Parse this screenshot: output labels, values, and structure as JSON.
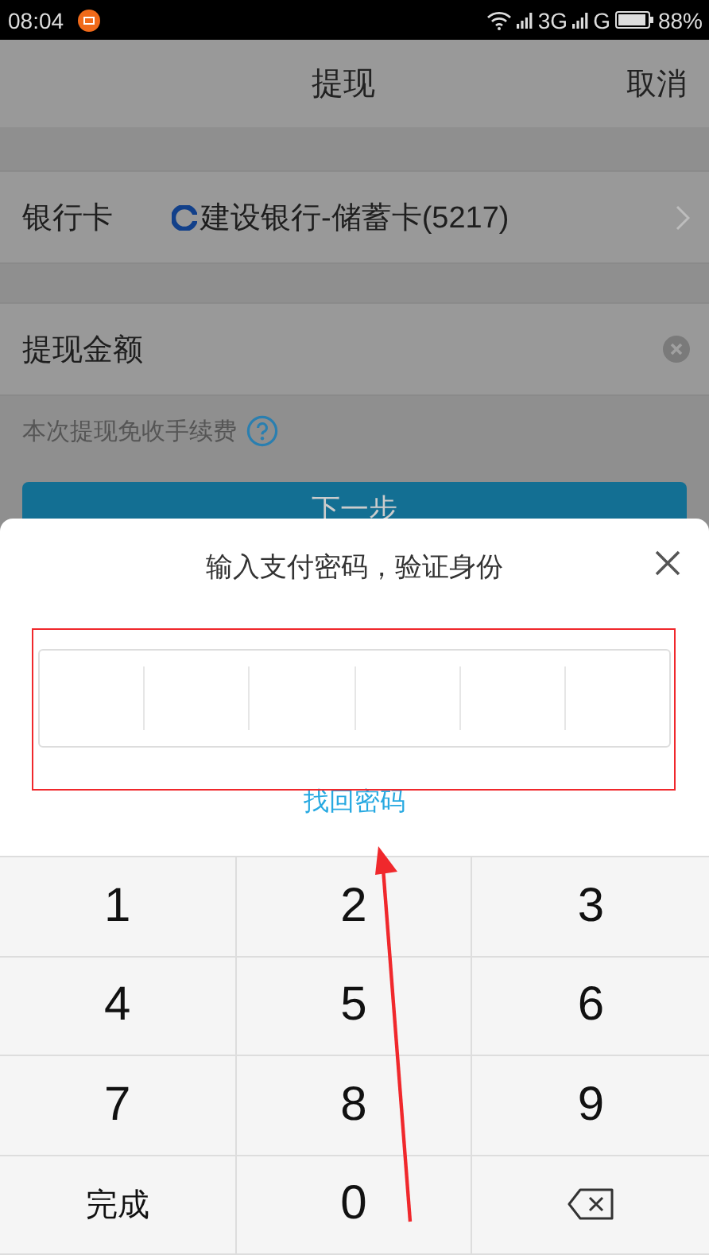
{
  "status_bar": {
    "time": "08:04",
    "network_1": "3G",
    "network_2": "G",
    "battery": "88%"
  },
  "header": {
    "title": "提现",
    "cancel": "取消"
  },
  "bank_card": {
    "label": "银行卡",
    "value": "建设银行-储蓄卡(5217)"
  },
  "amount": {
    "label": "提现金额"
  },
  "fee_note": "本次提现免收手续费",
  "next_button": "下一步",
  "dialog": {
    "title": "输入支付密码，验证身份",
    "link": "找回密码"
  },
  "keypad": [
    {
      "kind": "digit",
      "label": "1"
    },
    {
      "kind": "digit",
      "label": "2"
    },
    {
      "kind": "digit",
      "label": "3"
    },
    {
      "kind": "digit",
      "label": "4"
    },
    {
      "kind": "digit",
      "label": "5"
    },
    {
      "kind": "digit",
      "label": "6"
    },
    {
      "kind": "digit",
      "label": "7"
    },
    {
      "kind": "digit",
      "label": "8"
    },
    {
      "kind": "digit",
      "label": "9"
    },
    {
      "kind": "action",
      "label": "完成"
    },
    {
      "kind": "digit",
      "label": "0"
    },
    {
      "kind": "delete"
    }
  ],
  "annotation_box": true,
  "annotation_arrow": true
}
